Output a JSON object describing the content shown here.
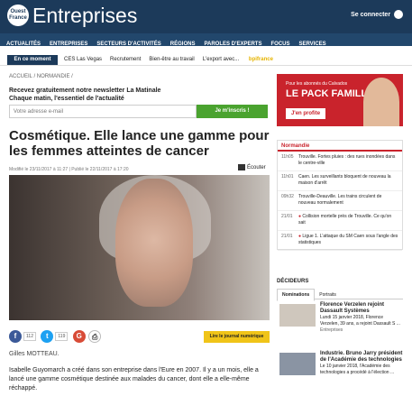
{
  "header": {
    "logo_text": "Ouest France",
    "brand": "Entreprises",
    "connect": "Se connecter"
  },
  "nav": [
    "ACTUALITÉS",
    "ENTREPRISES",
    "SECTEURS D'ACTIVITÉS",
    "RÉGIONS",
    "PAROLES D'EXPERTS",
    "FOCUS",
    "SERVICES"
  ],
  "moment": {
    "label": "En ce moment",
    "items": [
      "CES Las Vegas",
      "Recrutement",
      "Bien-être au travail",
      "L'export avec... ",
      "bpifrance"
    ]
  },
  "breadcrumb": "ACCUEIL  /  NORMANDIE  /",
  "newsletter": {
    "line1": "Recevez gratuitement notre newsletter La Matinale",
    "line2": "Chaque matin, l'essentiel de l'actualité",
    "placeholder": "Votre adresse e-mail",
    "button": "Je m'inscris !"
  },
  "ad": {
    "line1": "Pour les abonnés du Calvados",
    "line2": "LE PACK FAMILLE",
    "cta": "J'en profite"
  },
  "article": {
    "title": "Cosmétique. Elle lance une gamme pour les femmes atteintes de cancer",
    "dates": "Modifié le 23/11/2017 à 11:27 | Publié le 22/11/2017 à 17:20",
    "listen": "Écouter",
    "share": {
      "fb": "112",
      "tw": "119"
    },
    "read_journal": "Lire le journal numérique",
    "credit": "Gilles MOTTEAU.",
    "body": "Isabelle Guyomarch a créé dans son entreprise dans l'Eure en 2007. Il y a un mois, elle a lancé une gamme cosmétique destinée aux malades du cancer, dont elle a elle-même réchappé."
  },
  "normandie": {
    "header": "Normandie",
    "items": [
      {
        "time": "11h05",
        "text": "Trouville. Fortes pluies : des rues inondées dans le centre-ville",
        "pic": false
      },
      {
        "time": "11h01",
        "text": "Caen. Les surveillants bloquent de nouveau la maison d'arrêt",
        "pic": false
      },
      {
        "time": "09h32",
        "text": "Trouville-Deauville. Les trains circulent de nouveau normalement",
        "pic": false
      },
      {
        "time": "21/01",
        "text": "Collision mortelle près de Trouville. Ce qu'on sait",
        "pic": true
      },
      {
        "time": "21/01",
        "text": "Ligue 1. L'attaque du SM Caen sous l'angle des statistiques",
        "pic": true
      }
    ]
  },
  "decideurs": {
    "title": "DÉCIDEURS",
    "tabs": [
      "Nominations",
      "Portraits"
    ],
    "items": [
      {
        "title": "Florence Verzelen rejoint Dassault Systèmes",
        "text": "Lundi 15 janvier 2018, Florence Verzelen, 39 ans, a rejoint Dassault S ...",
        "source": "Entreprises"
      },
      {
        "title": "Industrie. Bruno Jarry président de l'Académie des technologies",
        "text": "Le 10 janvier 2018, l'Académie des technologies a procédé à l'élection ...",
        "source": ""
      }
    ]
  }
}
